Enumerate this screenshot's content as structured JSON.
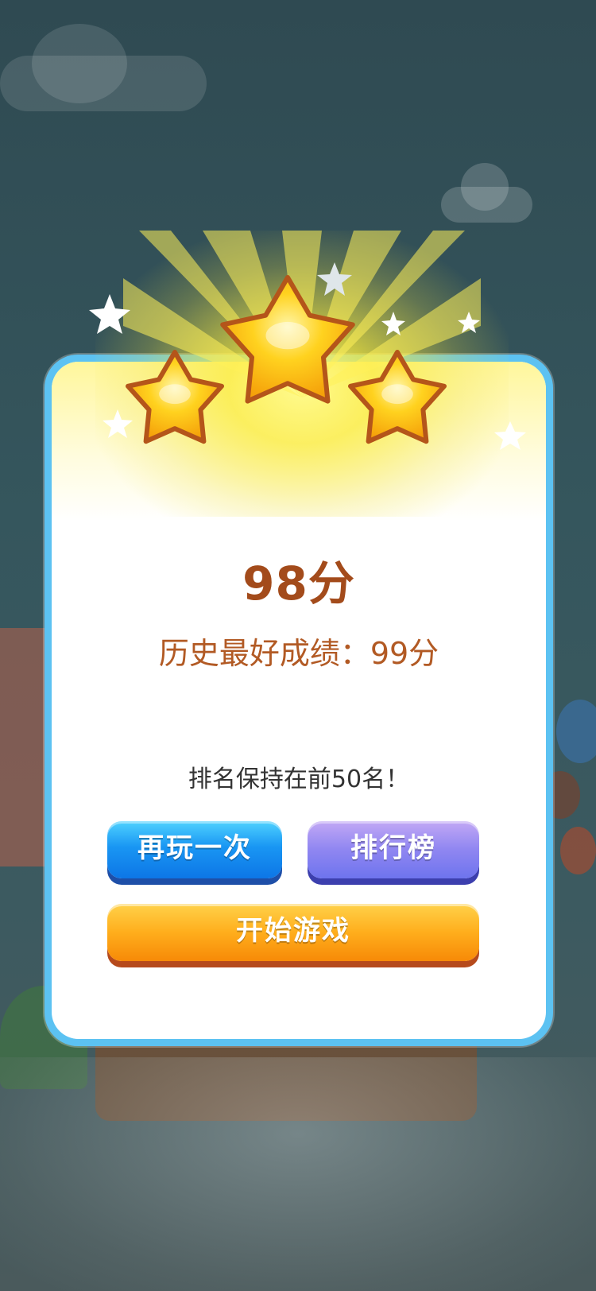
{
  "result": {
    "stars_earned": 3,
    "stars_total": 3,
    "score_text": "98分",
    "best_text": "历史最好成绩：99分",
    "rank_text": "排名保持在前50名！"
  },
  "buttons": {
    "replay": "再玩一次",
    "leaderboard": "排行榜",
    "start": "开始游戏"
  },
  "colors": {
    "dialog_border": "#5cc2f2",
    "score": "#a34b1b",
    "best": "#b25a24",
    "replay": "#1996f3",
    "leaderboard": "#8f86f1",
    "start": "#ffae1c",
    "star": "#ffd21f"
  }
}
